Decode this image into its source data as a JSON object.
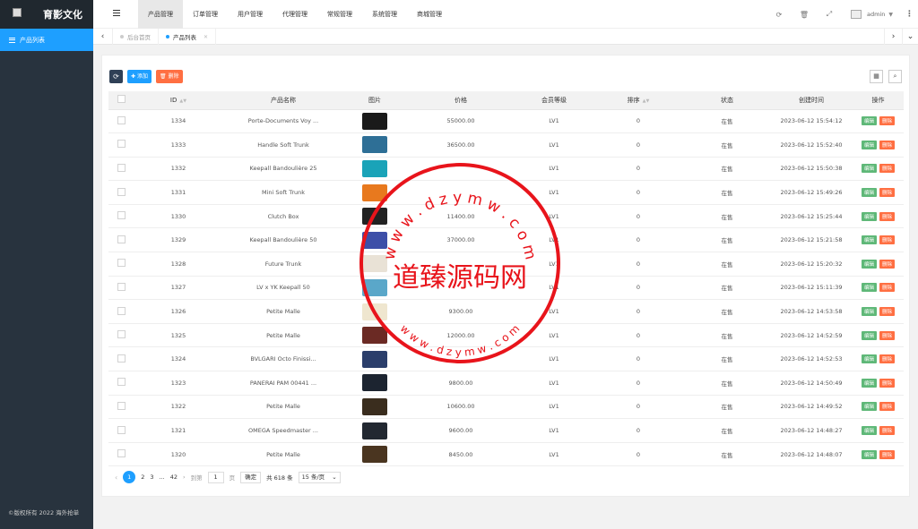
{
  "logo": {
    "alt": "logo",
    "brand": "育影文化"
  },
  "sidebar": {
    "items": [
      {
        "label": "产品列表"
      }
    ],
    "copyright": "©版权所有 2022 海外抢单"
  },
  "topnav": [
    "产品管理",
    "订单管理",
    "用户管理",
    "代理管理",
    "常规管理",
    "系统管理",
    "商城管理"
  ],
  "header": {
    "user": "admin"
  },
  "tabs": [
    {
      "label": "后台首页"
    },
    {
      "label": "产品列表"
    }
  ],
  "toolbar": {
    "add": "添加",
    "delete": "删除"
  },
  "table": {
    "columns": [
      "ID",
      "产品名称",
      "图片",
      "价格",
      "会员等级",
      "排序",
      "状态",
      "创建时间",
      "操作"
    ],
    "edit_label": "编辑",
    "delete_label": "删除",
    "rows": [
      {
        "id": "1334",
        "name": "Porte-Documents Voy ...",
        "price": "55000.00",
        "level": "LV1",
        "sort": "0",
        "status": "在售",
        "created": "2023-06-12 15:54:12",
        "img": "#1a1a1a"
      },
      {
        "id": "1333",
        "name": "Handle Soft Trunk",
        "price": "36500.00",
        "level": "LV1",
        "sort": "0",
        "status": "在售",
        "created": "2023-06-12 15:52:40",
        "img": "#2e6f96"
      },
      {
        "id": "1332",
        "name": "Keepall Bandoulière 25",
        "price": "",
        "level": "LV1",
        "sort": "0",
        "status": "在售",
        "created": "2023-06-12 15:50:38",
        "img": "#1aa3b8"
      },
      {
        "id": "1331",
        "name": "Mini Soft Trunk",
        "price": "",
        "level": "LV1",
        "sort": "0",
        "status": "在售",
        "created": "2023-06-12 15:49:26",
        "img": "#e8791e"
      },
      {
        "id": "1330",
        "name": "Clutch Box",
        "price": "11400.00",
        "level": "LV1",
        "sort": "0",
        "status": "在售",
        "created": "2023-06-12 15:25:44",
        "img": "#222222"
      },
      {
        "id": "1329",
        "name": "Keepall Bandoulière 50",
        "price": "37000.00",
        "level": "LV1",
        "sort": "0",
        "status": "在售",
        "created": "2023-06-12 15:21:58",
        "img": "#3d4fa8"
      },
      {
        "id": "1328",
        "name": "Future Trunk",
        "price": "",
        "level": "LV1",
        "sort": "0",
        "status": "在售",
        "created": "2023-06-12 15:20:32",
        "img": "#e9e2d6"
      },
      {
        "id": "1327",
        "name": "LV x YK Keepall 50",
        "price": "",
        "level": "LV1",
        "sort": "0",
        "status": "在售",
        "created": "2023-06-12 15:11:39",
        "img": "#5aa7c9"
      },
      {
        "id": "1326",
        "name": "Petite Malle",
        "price": "9300.00",
        "level": "LV1",
        "sort": "0",
        "status": "在售",
        "created": "2023-06-12 14:53:58",
        "img": "#efe6cf"
      },
      {
        "id": "1325",
        "name": "Petite Malle",
        "price": "12000.00",
        "level": "LV1",
        "sort": "0",
        "status": "在售",
        "created": "2023-06-12 14:52:59",
        "img": "#6b2a24"
      },
      {
        "id": "1324",
        "name": "BVLGARI Octo Finissi...",
        "price": "",
        "level": "LV1",
        "sort": "0",
        "status": "在售",
        "created": "2023-06-12 14:52:53",
        "img": "#2b3e6b"
      },
      {
        "id": "1323",
        "name": "PANERAI PAM 00441 ...",
        "price": "9800.00",
        "level": "LV1",
        "sort": "0",
        "status": "在售",
        "created": "2023-06-12 14:50:49",
        "img": "#1c2430"
      },
      {
        "id": "1322",
        "name": "Petite Malle",
        "price": "10600.00",
        "level": "LV1",
        "sort": "0",
        "status": "在售",
        "created": "2023-06-12 14:49:52",
        "img": "#3a2d1e"
      },
      {
        "id": "1321",
        "name": "OMEGA Speedmaster ...",
        "price": "9600.00",
        "level": "LV1",
        "sort": "0",
        "status": "在售",
        "created": "2023-06-12 14:48:27",
        "img": "#222831"
      },
      {
        "id": "1320",
        "name": "Petite Malle",
        "price": "8450.00",
        "level": "LV1",
        "sort": "0",
        "status": "在售",
        "created": "2023-06-12 14:48:07",
        "img": "#4a3520"
      }
    ]
  },
  "pager": {
    "current": "1",
    "p2": "2",
    "p3": "3",
    "ellipsis": "...",
    "last": "42",
    "goto": "到第",
    "input": "1",
    "page_unit": "页",
    "confirm": "确定",
    "total": "共 618 条",
    "size": "15 条/页"
  },
  "watermark": {
    "text": "道臻源码网",
    "url_top": "w w w . d z y m w . c o m",
    "url_bottom": "w w w . d z y m w . c o m",
    "color": "#e8141b"
  }
}
